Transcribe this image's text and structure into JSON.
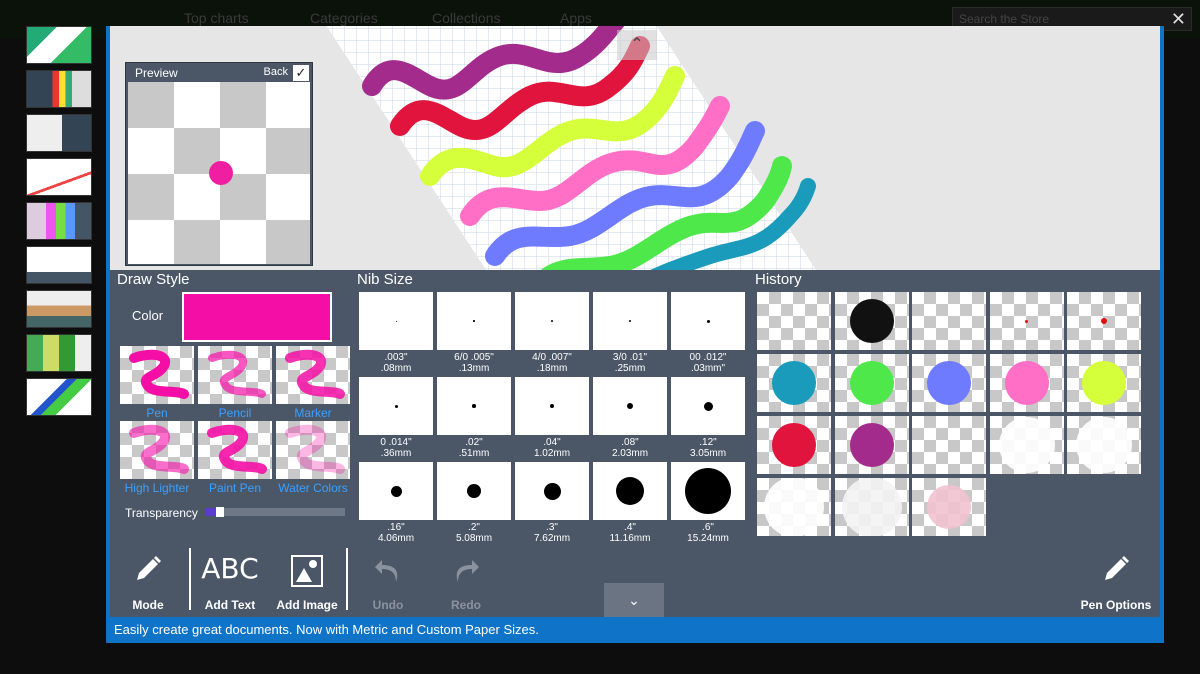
{
  "background": {
    "nav": [
      "Top charts",
      "Categories",
      "Collections",
      "Apps"
    ],
    "search_placeholder": "Search the Store",
    "close_glyph": "✕"
  },
  "window": {
    "collapse_up_glyph": "⌃",
    "collapse_down_glyph": "⌄"
  },
  "preview": {
    "title": "Preview",
    "back_label": "Back",
    "checked": true,
    "dot_color": "#f01ea0"
  },
  "draw_style": {
    "title": "Draw Style",
    "color_label": "Color",
    "color_value": "#f50ea6",
    "styles": [
      {
        "label": "Pen"
      },
      {
        "label": "Pencil"
      },
      {
        "label": "Marker"
      },
      {
        "label": "High Lighter"
      },
      {
        "label": "Paint Pen"
      },
      {
        "label": "Water Colors"
      }
    ],
    "transparency_label": "Transparency",
    "transparency_level": 0.08
  },
  "nib_size": {
    "title": "Nib Size",
    "nibs": [
      {
        "line1": ".003\"",
        "line2": ".08mm"
      },
      {
        "line1": "6/0 .005\"",
        "line2": ".13mm"
      },
      {
        "line1": "4/0 .007\"",
        "line2": ".18mm"
      },
      {
        "line1": "3/0 .01\"",
        "line2": ".25mm"
      },
      {
        "line1": "00 .012\"",
        "line2": ".03mm\""
      },
      {
        "line1": "0 .014\"",
        "line2": ".36mm"
      },
      {
        "line1": ".02\"",
        "line2": ".51mm"
      },
      {
        "line1": ".04\"",
        "line2": "1.02mm"
      },
      {
        "line1": ".08\"",
        "line2": "2.03mm"
      },
      {
        "line1": ".12\"",
        "line2": "3.05mm"
      },
      {
        "line1": ".16\"",
        "line2": "4.06mm"
      },
      {
        "line1": ".2\"",
        "line2": "5.08mm"
      },
      {
        "line1": ".3\"",
        "line2": "7.62mm"
      },
      {
        "line1": ".4\"",
        "line2": "11.16mm"
      },
      {
        "line1": ".6\"",
        "line2": "15.24mm"
      }
    ]
  },
  "history": {
    "title": "History",
    "items": [
      "none",
      "#111111",
      "none",
      "#e01010",
      "#e01010",
      "#1a9bbb",
      "#4ee84a",
      "#6f7bff",
      "#ff6fc6",
      "#d4ff3a",
      "#e0143c",
      "#a32b8c",
      "none",
      "#ffffff",
      "#ffffff",
      "#ffffff",
      "#f3f3f3",
      "#f1c2d0"
    ]
  },
  "toolbar": {
    "mode_label": "Mode",
    "add_text_glyph": "ABC",
    "add_text_label": "Add Text",
    "add_image_label": "Add Image",
    "undo_label": "Undo",
    "redo_label": "Redo",
    "pen_options_label": "Pen Options"
  },
  "status_text": "Easily create great documents.  Now with Metric and Custom Paper Sizes."
}
